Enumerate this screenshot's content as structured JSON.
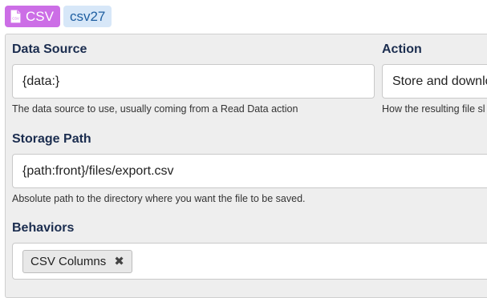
{
  "header": {
    "type_label": "CSV",
    "type_icon": "file-csv-icon",
    "type_color": "#cc6ee6",
    "id_label": "csv27"
  },
  "data_source": {
    "label": "Data Source",
    "value": "{data:}",
    "help": "The data source to use, usually coming from a Read Data action"
  },
  "action": {
    "label": "Action",
    "value": "Store and downlo",
    "help": "How the resulting file sl"
  },
  "storage_path": {
    "label": "Storage Path",
    "value": "{path:front}/files/export.csv",
    "help": "Absolute path to the directory where you want the file to be saved."
  },
  "behaviors": {
    "label": "Behaviors",
    "chips": [
      {
        "label": "CSV Columns",
        "remove_icon": "close-icon",
        "remove_glyph": "✖"
      }
    ]
  }
}
